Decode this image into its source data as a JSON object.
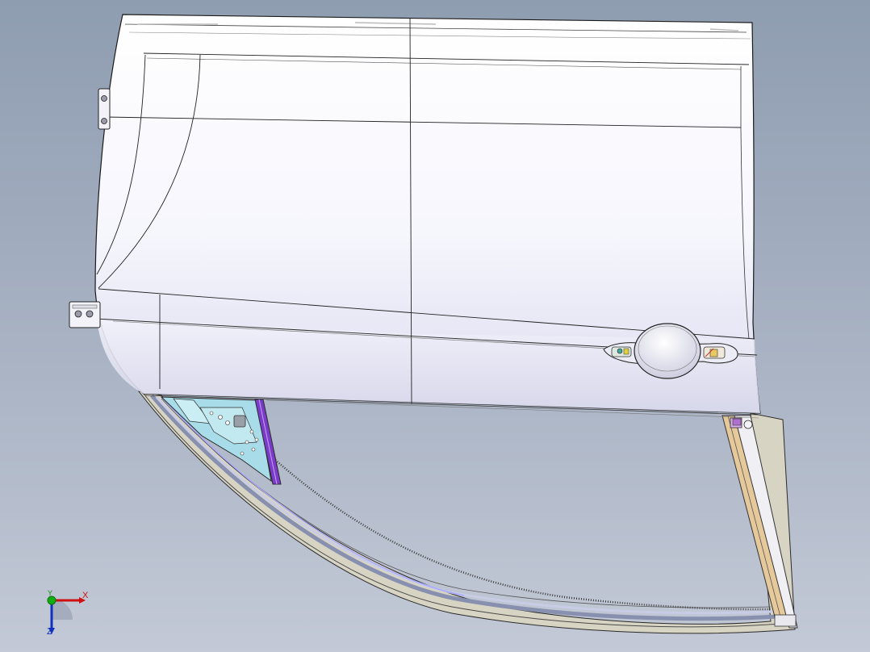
{
  "viewport": {
    "background_top": "#8f9db1",
    "background_bottom": "#c3c9d6"
  },
  "model": {
    "part": "car-door",
    "panel_color": "#f4f4fc",
    "edge_color": "#1a1a1a",
    "accent_colors": {
      "reinforcement": "#a8dce8",
      "purple_channel": "#7a3cc8",
      "tan_channel": "#e6c99a",
      "seal": "#dcd8c8"
    }
  },
  "triad": {
    "x_label": "X",
    "y_label": "Y",
    "z_label": "Z",
    "x_color": "#d01010",
    "y_color": "#10b010",
    "z_color": "#1030c0"
  }
}
